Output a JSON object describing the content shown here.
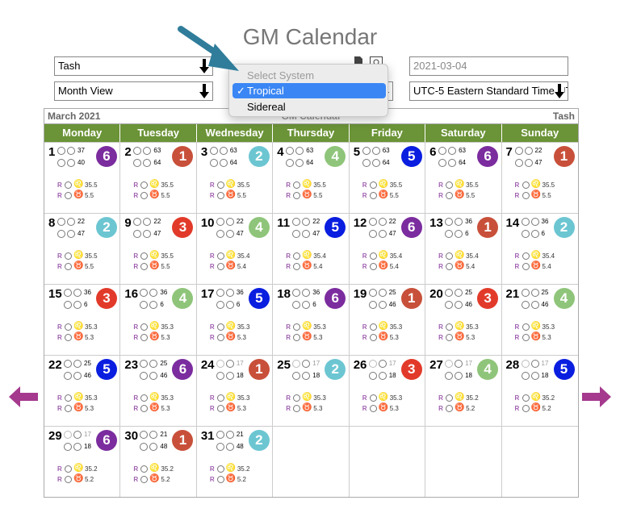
{
  "app": {
    "title": "GM Calendar"
  },
  "controls": {
    "user_select": "Tash",
    "view_select": "Month View",
    "date_input": "2021-03-04",
    "timezone_select": "UTC-5 Eastern Standard Time(UTC"
  },
  "dropdown": {
    "header": "Select System",
    "options": [
      {
        "label": "Tropical",
        "selected": true
      },
      {
        "label": "Sidereal",
        "selected": false
      }
    ],
    "check": "✓"
  },
  "calendar": {
    "month_label": "March 2021",
    "ghost_title": "GM Calendar",
    "user_label": "Tash",
    "weekdays": [
      "Monday",
      "Tuesday",
      "Wednesday",
      "Thursday",
      "Friday",
      "Saturday",
      "Sunday"
    ],
    "r_label": "R",
    "glyph_top": "♌",
    "glyph_bottom": "♉",
    "badge_colors": {
      "1": "#c8503a",
      "2": "#6cc6d2",
      "3": "#e23a2a",
      "4": "#8fc57a",
      "5": "#0a1ee0",
      "6": "#7b2c9e"
    },
    "weeks": [
      [
        {
          "day": "1",
          "a": "37",
          "b": "40",
          "badge": "6",
          "r1": "35.5",
          "r2": "5.5",
          "light": false
        },
        {
          "day": "2",
          "a": "63",
          "b": "64",
          "badge": "1",
          "r1": "35.5",
          "r2": "5.5",
          "light": false
        },
        {
          "day": "3",
          "a": "63",
          "b": "64",
          "badge": "2",
          "r1": "35.5",
          "r2": "5.5",
          "light": false
        },
        {
          "day": "4",
          "a": "63",
          "b": "64",
          "badge": "4",
          "r1": "35.5",
          "r2": "5.5",
          "light": false
        },
        {
          "day": "5",
          "a": "63",
          "b": "64",
          "badge": "5",
          "r1": "35.5",
          "r2": "5.5",
          "light": false
        },
        {
          "day": "6",
          "a": "63",
          "b": "64",
          "badge": "6",
          "r1": "35.5",
          "r2": "5.5",
          "light": false
        },
        {
          "day": "7",
          "a": "22",
          "b": "47",
          "badge": "1",
          "r1": "35.5",
          "r2": "5.5",
          "light": false
        }
      ],
      [
        {
          "day": "8",
          "a": "22",
          "b": "47",
          "badge": "2",
          "r1": "35.5",
          "r2": "5.5",
          "light": false
        },
        {
          "day": "9",
          "a": "22",
          "b": "47",
          "badge": "3",
          "r1": "35.5",
          "r2": "5.5",
          "light": false
        },
        {
          "day": "10",
          "a": "22",
          "b": "47",
          "badge": "4",
          "r1": "35.4",
          "r2": "5.4",
          "light": false
        },
        {
          "day": "11",
          "a": "22",
          "b": "47",
          "badge": "5",
          "r1": "35.4",
          "r2": "5.4",
          "light": false
        },
        {
          "day": "12",
          "a": "22",
          "b": "47",
          "badge": "6",
          "r1": "35.4",
          "r2": "5.4",
          "light": false
        },
        {
          "day": "13",
          "a": "36",
          "b": "6",
          "badge": "1",
          "r1": "35.4",
          "r2": "5.4",
          "light": false
        },
        {
          "day": "14",
          "a": "36",
          "b": "6",
          "badge": "2",
          "r1": "35.4",
          "r2": "5.4",
          "light": false
        }
      ],
      [
        {
          "day": "15",
          "a": "36",
          "b": "6",
          "badge": "3",
          "r1": "35.3",
          "r2": "5.3",
          "light": false
        },
        {
          "day": "16",
          "a": "36",
          "b": "6",
          "badge": "4",
          "r1": "35.3",
          "r2": "5.3",
          "light": false
        },
        {
          "day": "17",
          "a": "36",
          "b": "6",
          "badge": "5",
          "r1": "35.3",
          "r2": "5.3",
          "light": false
        },
        {
          "day": "18",
          "a": "36",
          "b": "6",
          "badge": "6",
          "r1": "35.3",
          "r2": "5.3",
          "light": false
        },
        {
          "day": "19",
          "a": "25",
          "b": "46",
          "badge": "1",
          "r1": "35.3",
          "r2": "5.3",
          "light": false
        },
        {
          "day": "20",
          "a": "25",
          "b": "46",
          "badge": "3",
          "r1": "35.3",
          "r2": "5.3",
          "light": false
        },
        {
          "day": "21",
          "a": "25",
          "b": "46",
          "badge": "4",
          "r1": "35.3",
          "r2": "5.3",
          "light": false
        }
      ],
      [
        {
          "day": "22",
          "a": "25",
          "b": "46",
          "badge": "5",
          "r1": "35.3",
          "r2": "5.3",
          "light": false
        },
        {
          "day": "23",
          "a": "25",
          "b": "46",
          "badge": "6",
          "r1": "35.3",
          "r2": "5.3",
          "light": false
        },
        {
          "day": "24",
          "a": "17",
          "b": "18",
          "badge": "1",
          "r1": "35.3",
          "r2": "5.3",
          "light": true
        },
        {
          "day": "25",
          "a": "17",
          "b": "18",
          "badge": "2",
          "r1": "35.3",
          "r2": "5.3",
          "light": true
        },
        {
          "day": "26",
          "a": "17",
          "b": "18",
          "badge": "3",
          "r1": "35.3",
          "r2": "5.3",
          "light": true
        },
        {
          "day": "27",
          "a": "17",
          "b": "18",
          "badge": "4",
          "r1": "35.2",
          "r2": "5.2",
          "light": true
        },
        {
          "day": "28",
          "a": "17",
          "b": "18",
          "badge": "5",
          "r1": "35.2",
          "r2": "5.2",
          "light": true
        }
      ],
      [
        {
          "day": "29",
          "a": "17",
          "b": "18",
          "badge": "6",
          "r1": "35.2",
          "r2": "5.2",
          "light": true
        },
        {
          "day": "30",
          "a": "21",
          "b": "48",
          "badge": "1",
          "r1": "35.2",
          "r2": "5.2",
          "light": false
        },
        {
          "day": "31",
          "a": "21",
          "b": "48",
          "badge": "2",
          "r1": "35.2",
          "r2": "5.2",
          "light": false
        },
        null,
        null,
        null,
        null
      ]
    ]
  },
  "nav": {
    "prev_color": "#a5398e",
    "next_color": "#a5398e"
  }
}
